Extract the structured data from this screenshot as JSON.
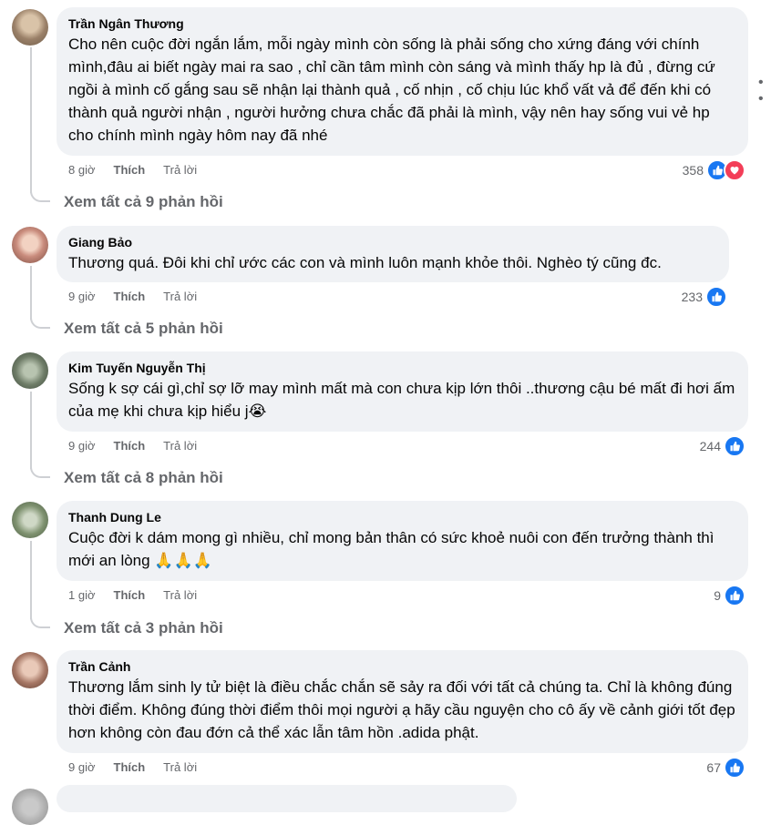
{
  "comments": [
    {
      "author": "Trần Ngân Thương",
      "text": "Cho nên cuộc đời ngắn lắm, mỗi ngày mình còn sống là phải sống cho xứng đáng với chính mình,đâu ai biết ngày mai ra sao , chỉ cần tâm mình còn sáng và mình thấy hp là đủ , đừng cứ ngồi à mình cố gắng sau sẽ nhận lại thành quả , cố nhịn , cố chịu lúc khổ vất vả để đến khi có thành quả người nhận , người hưởng chưa chắc đã phải là mình, vậy nên hay sống vui vẻ hp cho chính mình ngày hôm nay đã nhé",
      "time": "8 giờ",
      "like_label": "Thích",
      "reply_label": "Trả lời",
      "reactions": "358",
      "view_replies": "Xem tất cả 9 phản hồi"
    },
    {
      "author": "Giang Bảo",
      "text": "Thương quá. Đôi khi chỉ ước các con và mình luôn mạnh khỏe thôi. Nghèo tý cũng đc.",
      "time": "9 giờ",
      "like_label": "Thích",
      "reply_label": "Trả lời",
      "reactions": "233",
      "view_replies": "Xem tất cả 5 phản hồi"
    },
    {
      "author": "Kim Tuyến Nguyễn Thị",
      "text": "Sống k sợ cái gì,chỉ sợ lỡ may mình mất mà con chưa kịp lớn thôi ..thương cậu bé mất đi hơi ấm của mẹ khi chưa kịp hiểu j😭",
      "time": "9 giờ",
      "like_label": "Thích",
      "reply_label": "Trả lời",
      "reactions": "244",
      "view_replies": "Xem tất cả 8 phản hồi"
    },
    {
      "author": "Thanh Dung Le",
      "text": "Cuộc đời k dám mong gì nhiều, chỉ mong bản thân có sức khoẻ nuôi con đến trưởng thành thì mới an lòng 🙏🙏🙏",
      "time": "1 giờ",
      "like_label": "Thích",
      "reply_label": "Trả lời",
      "reactions": "9",
      "view_replies": "Xem tất cả 3 phản hồi"
    },
    {
      "author": "Trần Cảnh",
      "text": "Thương lắm sinh ly tử biệt là điều chắc chắn sẽ sảy ra đối với tất cả chúng ta. Chỉ là không đúng thời điểm. Không đúng thời điểm thôi mọi người ạ hãy cầu nguyện cho cô ấy về cảnh giới tốt đẹp hơn không còn đau đớn cả thể xác lẫn tâm hồn .adida phật.",
      "time": "9 giờ",
      "like_label": "Thích",
      "reply_label": "Trả lời",
      "reactions": "67"
    }
  ],
  "more_icon": "more-horizontal-icon",
  "colors": {
    "like_blue": "#1877f2",
    "love_red": "#f33e58",
    "bubble": "#f0f2f5",
    "muted": "#65676b"
  }
}
